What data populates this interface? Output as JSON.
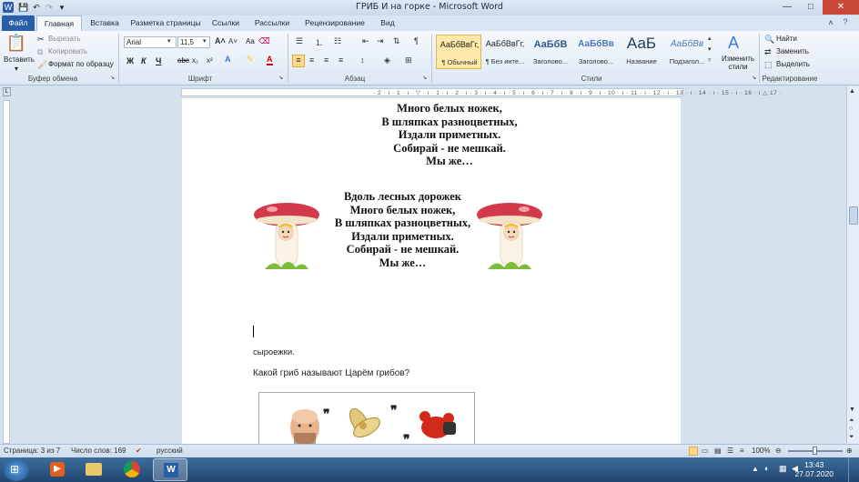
{
  "window": {
    "title": "ГРИБ И на горке - Microsoft Word",
    "minimize": "—",
    "maximize": "□",
    "close": "✕"
  },
  "tabs": [
    "Файл",
    "Главная",
    "Вставка",
    "Разметка страницы",
    "Ссылки",
    "Рассылки",
    "Рецензирование",
    "Вид"
  ],
  "clipboard": {
    "paste": "Вставить",
    "cut": "Вырезать",
    "copy": "Копировать",
    "format_painter": "Формат по образцу",
    "label": "Буфер обмена"
  },
  "font": {
    "name": "Arial",
    "size": "11,5",
    "label": "Шрифт",
    "aa": "Aa",
    "bold": "Ж",
    "italic": "К",
    "underline": "Ч",
    "strike": "abc",
    "sub": "x₂",
    "sup": "x²"
  },
  "paragraph": {
    "label": "Абзац"
  },
  "styles": {
    "label": "Стили",
    "items": [
      {
        "sample": "АаБбВвГг,",
        "name": "¶ Обычный"
      },
      {
        "sample": "АаБбВвГг,",
        "name": "¶ Без инте..."
      },
      {
        "sample": "АаБбВ",
        "name": "Заголово..."
      },
      {
        "sample": "АаБбВв",
        "name": "Заголово..."
      },
      {
        "sample": "АаБ",
        "name": "Название"
      },
      {
        "sample": "АаБбВв",
        "name": "Подзагол..."
      }
    ],
    "change": "Изменить стили"
  },
  "editing": {
    "label": "Редактирование",
    "find": "Найти",
    "replace": "Заменить",
    "select": "Выделить"
  },
  "document": {
    "poem1": [
      "Много белых ножек,",
      "В шляпках разноцветных,",
      "Издали приметных.",
      "Собирай - не мешкай.",
      "Мы же…"
    ],
    "poem2": [
      "Вдоль лесных дорожек",
      "Много белых ножек,",
      "В шляпках разноцветных,",
      "Издали приметных.",
      "Собирай - не мешкай.",
      "Мы же…"
    ],
    "answer": "сыроежки.",
    "question": "Какой гриб называют  Царём  грибов?"
  },
  "statusbar": {
    "page": "Страница: 3 из 7",
    "words": "Число слов: 169",
    "language": "русский",
    "zoom": "100%"
  },
  "taskbar": {
    "time": "13:43",
    "date": "27.07.2020"
  },
  "colors": {
    "file_tab": "#2a5ea8",
    "mushroom_cap": "#d23a4a",
    "close_button": "#c9483a"
  }
}
